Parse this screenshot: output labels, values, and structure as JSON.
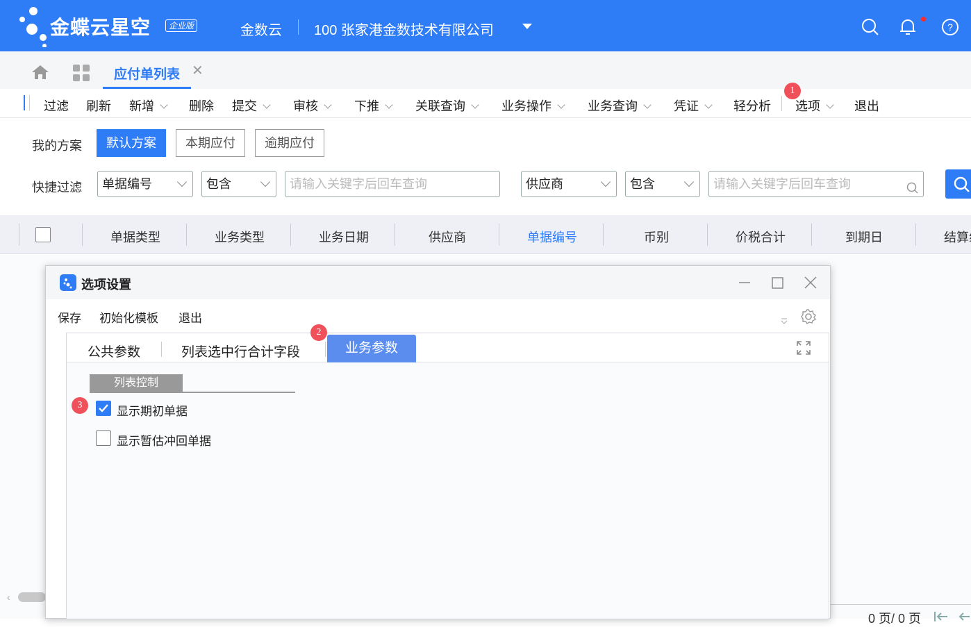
{
  "app": {
    "brand": "金蝶云星空",
    "edition": "企业版",
    "cloud": "金数云",
    "company": "100  张家港金数技术有限公司"
  },
  "tabs": {
    "active": "应付单列表"
  },
  "toolbar": {
    "items": [
      "过滤",
      "刷新",
      "新增",
      "删除",
      "提交",
      "审核",
      "下推",
      "关联查询",
      "业务操作",
      "业务查询",
      "凭证",
      "轻分析",
      "选项",
      "退出"
    ]
  },
  "filter": {
    "my_scheme_label": "我的方案",
    "schemes": [
      "默认方案",
      "本期应付",
      "逾期应付"
    ],
    "quick_filter_label": "快捷过滤",
    "field1": "单据编号",
    "op1": "包含",
    "placeholder1": "请输入关键字后回车查询",
    "field2": "供应商",
    "op2": "包含",
    "placeholder2": "请输入关键字后回车查询"
  },
  "grid": {
    "columns": [
      "单据类型",
      "业务类型",
      "业务日期",
      "供应商",
      "单据编号",
      "币别",
      "价税合计",
      "到期日",
      "结算组织"
    ],
    "pager": "0 页/ 0 页"
  },
  "dialog": {
    "title": "选项设置",
    "menu": [
      "保存",
      "初始化模板",
      "退出"
    ],
    "tabs": [
      "公共参数",
      "列表选中行合计字段",
      "业务参数"
    ],
    "section": "列表控制",
    "options": [
      {
        "label": "显示期初单据",
        "checked": true
      },
      {
        "label": "显示暂估冲回单据",
        "checked": false
      }
    ]
  },
  "badges": [
    "1",
    "2",
    "3"
  ],
  "colors": {
    "primary": "#2e7cf6",
    "badge": "#f0505a"
  }
}
